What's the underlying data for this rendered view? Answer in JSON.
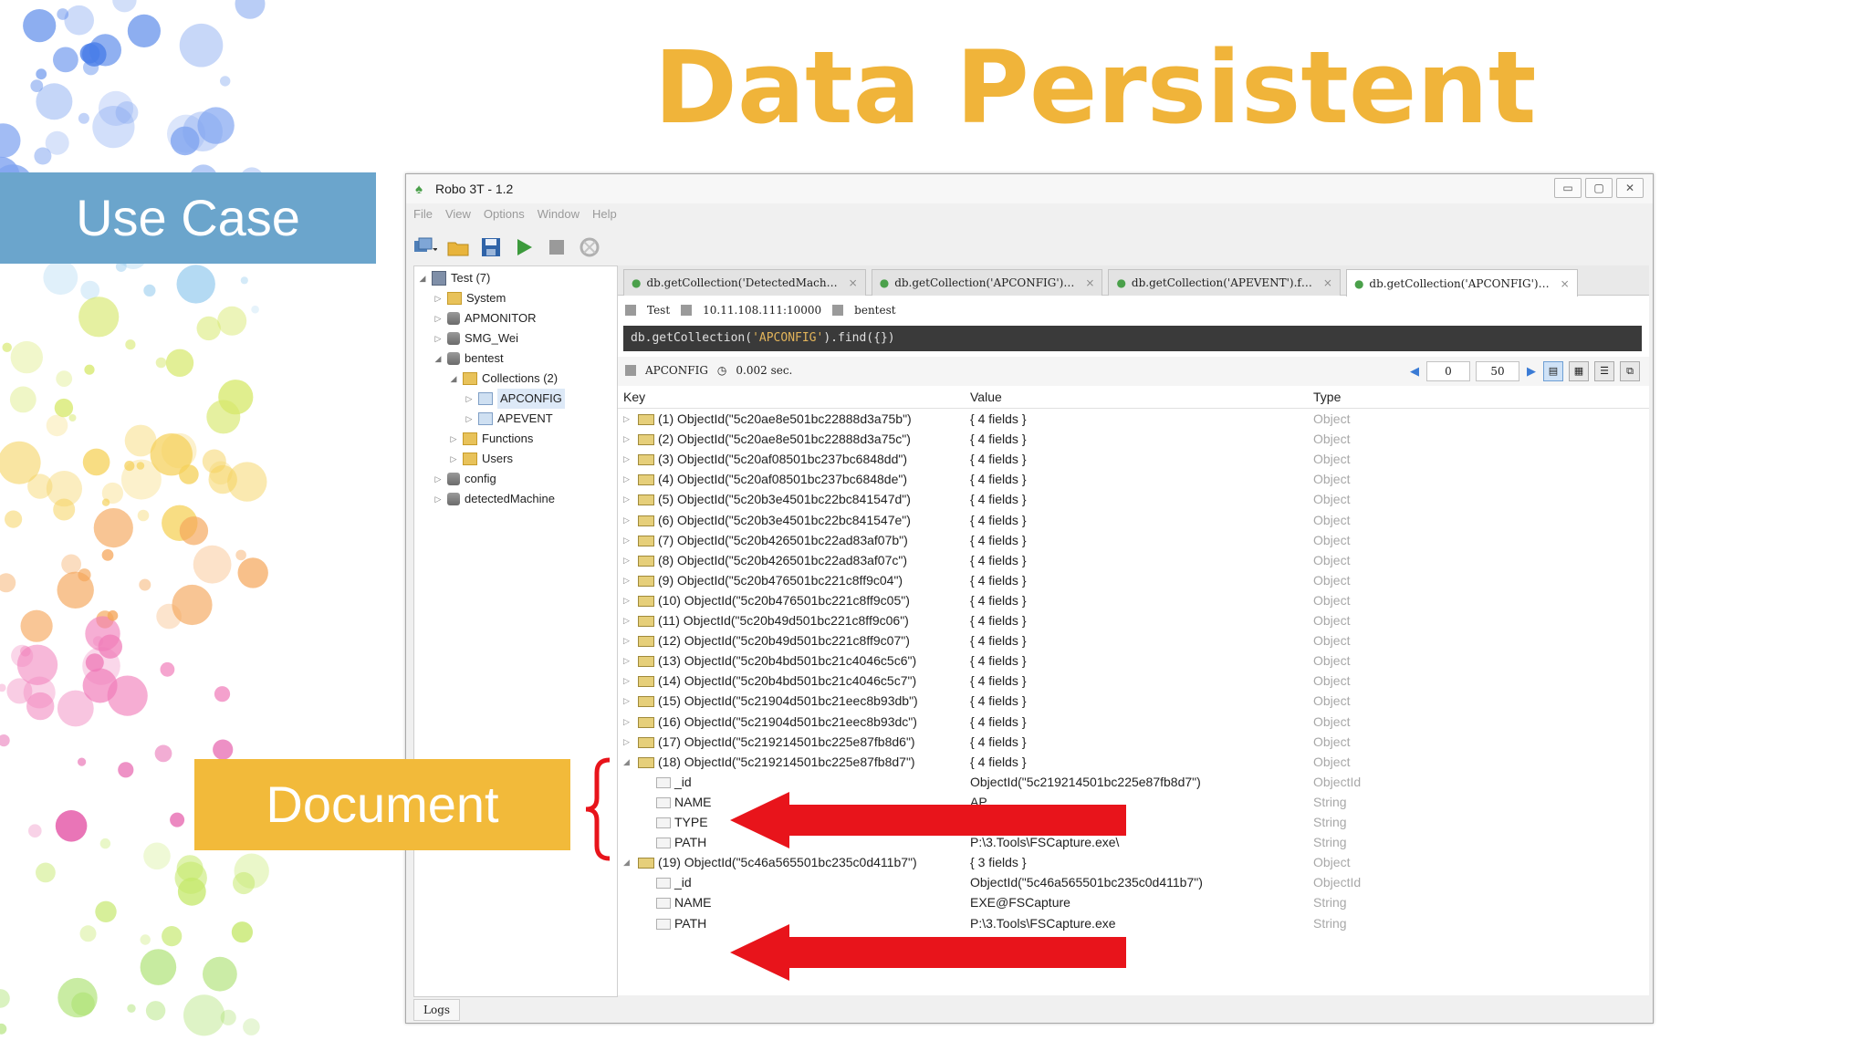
{
  "slide": {
    "title": "Data Persistent",
    "use_case_label": "Use Case",
    "document_label": "Document"
  },
  "window": {
    "title": "Robo 3T - 1.2",
    "controls": [
      "▭",
      "▢",
      "✕"
    ]
  },
  "menu": [
    "File",
    "View",
    "Options",
    "Window",
    "Help"
  ],
  "toolbar_icons": [
    "connect-icon",
    "open-folder-icon",
    "save-icon",
    "run-icon",
    "stop-icon",
    "format-icon"
  ],
  "tree": [
    {
      "label": "Test (7)",
      "level": 0,
      "expanded": true,
      "icon": "server"
    },
    {
      "label": "System",
      "level": 1,
      "expanded": false,
      "icon": "folder"
    },
    {
      "label": "APMONITOR",
      "level": 1,
      "expanded": false,
      "icon": "db"
    },
    {
      "label": "SMG_Wei",
      "level": 1,
      "expanded": false,
      "icon": "db"
    },
    {
      "label": "bentest",
      "level": 1,
      "expanded": true,
      "icon": "db"
    },
    {
      "label": "Collections (2)",
      "level": 2,
      "expanded": true,
      "icon": "folder"
    },
    {
      "label": "APCONFIG",
      "level": 3,
      "expanded": false,
      "icon": "table",
      "selected": true
    },
    {
      "label": "APEVENT",
      "level": 3,
      "expanded": false,
      "icon": "table"
    },
    {
      "label": "Functions",
      "level": 2,
      "expanded": false,
      "icon": "folder"
    },
    {
      "label": "Users",
      "level": 2,
      "expanded": false,
      "icon": "folder"
    },
    {
      "label": "config",
      "level": 1,
      "expanded": false,
      "icon": "db"
    },
    {
      "label": "detectedMachine",
      "level": 1,
      "expanded": false,
      "icon": "db"
    }
  ],
  "tabs": [
    {
      "label": "db.getCollection('DetectedMach…",
      "active": false
    },
    {
      "label": "db.getCollection('APCONFIG')…",
      "active": false
    },
    {
      "label": "db.getCollection('APEVENT').f…",
      "active": false
    },
    {
      "label": "db.getCollection('APCONFIG')…",
      "active": true
    }
  ],
  "info": {
    "connection": "Test",
    "address": "10.11.108.111:10000",
    "database": "bentest"
  },
  "query": {
    "prefix": "db.getCollection(",
    "arg": "'APCONFIG'",
    "suffix": ").find({})"
  },
  "result_bar": {
    "collection": "APCONFIG",
    "time": "0.002 sec.",
    "page_start": "0",
    "page_size": "50"
  },
  "columns": {
    "key": "Key",
    "value": "Value",
    "type": "Type"
  },
  "rows": [
    {
      "key": "(1) ObjectId(\"5c20ae8e501bc22888d3a75b\")",
      "value": "{ 4 fields }",
      "type": "Object",
      "kind": "doc",
      "expand": "closed"
    },
    {
      "key": "(2) ObjectId(\"5c20ae8e501bc22888d3a75c\")",
      "value": "{ 4 fields }",
      "type": "Object",
      "kind": "doc",
      "expand": "closed"
    },
    {
      "key": "(3) ObjectId(\"5c20af08501bc237bc6848dd\")",
      "value": "{ 4 fields }",
      "type": "Object",
      "kind": "doc",
      "expand": "closed"
    },
    {
      "key": "(4) ObjectId(\"5c20af08501bc237bc6848de\")",
      "value": "{ 4 fields }",
      "type": "Object",
      "kind": "doc",
      "expand": "closed"
    },
    {
      "key": "(5) ObjectId(\"5c20b3e4501bc22bc841547d\")",
      "value": "{ 4 fields }",
      "type": "Object",
      "kind": "doc",
      "expand": "closed"
    },
    {
      "key": "(6) ObjectId(\"5c20b3e4501bc22bc841547e\")",
      "value": "{ 4 fields }",
      "type": "Object",
      "kind": "doc",
      "expand": "closed"
    },
    {
      "key": "(7) ObjectId(\"5c20b426501bc22ad83af07b\")",
      "value": "{ 4 fields }",
      "type": "Object",
      "kind": "doc",
      "expand": "closed"
    },
    {
      "key": "(8) ObjectId(\"5c20b426501bc22ad83af07c\")",
      "value": "{ 4 fields }",
      "type": "Object",
      "kind": "doc",
      "expand": "closed"
    },
    {
      "key": "(9) ObjectId(\"5c20b476501bc221c8ff9c04\")",
      "value": "{ 4 fields }",
      "type": "Object",
      "kind": "doc",
      "expand": "closed"
    },
    {
      "key": "(10) ObjectId(\"5c20b476501bc221c8ff9c05\")",
      "value": "{ 4 fields }",
      "type": "Object",
      "kind": "doc",
      "expand": "closed"
    },
    {
      "key": "(11) ObjectId(\"5c20b49d501bc221c8ff9c06\")",
      "value": "{ 4 fields }",
      "type": "Object",
      "kind": "doc",
      "expand": "closed"
    },
    {
      "key": "(12) ObjectId(\"5c20b49d501bc221c8ff9c07\")",
      "value": "{ 4 fields }",
      "type": "Object",
      "kind": "doc",
      "expand": "closed"
    },
    {
      "key": "(13) ObjectId(\"5c20b4bd501bc21c4046c5c6\")",
      "value": "{ 4 fields }",
      "type": "Object",
      "kind": "doc",
      "expand": "closed"
    },
    {
      "key": "(14) ObjectId(\"5c20b4bd501bc21c4046c5c7\")",
      "value": "{ 4 fields }",
      "type": "Object",
      "kind": "doc",
      "expand": "closed"
    },
    {
      "key": "(15) ObjectId(\"5c21904d501bc21eec8b93db\")",
      "value": "{ 4 fields }",
      "type": "Object",
      "kind": "doc",
      "expand": "closed"
    },
    {
      "key": "(16) ObjectId(\"5c21904d501bc21eec8b93dc\")",
      "value": "{ 4 fields }",
      "type": "Object",
      "kind": "doc",
      "expand": "closed"
    },
    {
      "key": "(17) ObjectId(\"5c219214501bc225e87fb8d6\")",
      "value": "{ 4 fields }",
      "type": "Object",
      "kind": "doc",
      "expand": "closed"
    },
    {
      "key": "(18) ObjectId(\"5c219214501bc225e87fb8d7\")",
      "value": "{ 4 fields }",
      "type": "Object",
      "kind": "doc",
      "expand": "open"
    },
    {
      "key": "_id",
      "value": "ObjectId(\"5c219214501bc225e87fb8d7\")",
      "type": "ObjectId",
      "kind": "field"
    },
    {
      "key": "NAME",
      "value": "AP",
      "type": "String",
      "kind": "field"
    },
    {
      "key": "TYPE",
      "value": "",
      "type": "String",
      "kind": "field"
    },
    {
      "key": "PATH",
      "value": "P:\\3.Tools\\FSCapture.exe\\",
      "type": "String",
      "kind": "field"
    },
    {
      "key": "(19) ObjectId(\"5c46a565501bc235c0d411b7\")",
      "value": "{ 3 fields }",
      "type": "Object",
      "kind": "doc",
      "expand": "open"
    },
    {
      "key": "_id",
      "value": "ObjectId(\"5c46a565501bc235c0d411b7\")",
      "type": "ObjectId",
      "kind": "field"
    },
    {
      "key": "NAME",
      "value": "EXE@FSCapture",
      "type": "String",
      "kind": "field"
    },
    {
      "key": "PATH",
      "value": "P:\\3.Tools\\FSCapture.exe",
      "type": "String",
      "kind": "field"
    }
  ],
  "logs_tab": "Logs",
  "colors": {
    "title": "#f0b43a",
    "use_case_bg": "#6ba5cc",
    "document_bg": "#f2ba3a",
    "arrow": "#e8141b"
  }
}
